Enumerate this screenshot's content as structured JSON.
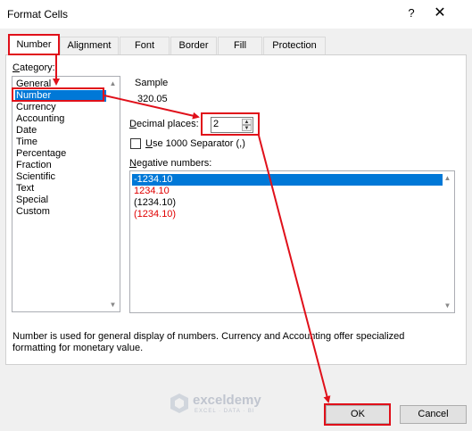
{
  "window": {
    "title": "Format Cells",
    "help_label": "?",
    "close_label": "✕"
  },
  "tabs": [
    {
      "label": "Number",
      "active": true
    },
    {
      "label": "Alignment",
      "active": false
    },
    {
      "label": "Font",
      "active": false
    },
    {
      "label": "Border",
      "active": false
    },
    {
      "label": "Fill",
      "active": false
    },
    {
      "label": "Protection",
      "active": false
    }
  ],
  "category": {
    "label": "Category",
    "label_rest": "ategory:",
    "label_accel": "C",
    "items": [
      "General",
      "Number",
      "Currency",
      "Accounting",
      "Date",
      "Time",
      "Percentage",
      "Fraction",
      "Scientific",
      "Text",
      "Special",
      "Custom"
    ],
    "selected": "Number"
  },
  "sample": {
    "label": "Sample",
    "value": "320.05"
  },
  "decimal_places": {
    "label_accel": "D",
    "label_rest": "ecimal places:",
    "value": "2"
  },
  "separator": {
    "label_accel": "U",
    "label_rest": "se 1000 Separator (,)",
    "checked": false
  },
  "negative_numbers": {
    "label_accel": "N",
    "label_rest": "egative numbers:",
    "items": [
      {
        "text": "-1234.10",
        "color": "#000000",
        "selected": true
      },
      {
        "text": "1234.10",
        "color": "#e00000",
        "selected": false
      },
      {
        "text": "(1234.10)",
        "color": "#000000",
        "selected": false
      },
      {
        "text": "(1234.10)",
        "color": "#e00000",
        "selected": false
      }
    ]
  },
  "description": {
    "line1": "Number is used for general display of numbers.  Currency and Accounting offer specialized",
    "line2": "formatting for monetary value."
  },
  "buttons": {
    "ok": "OK",
    "cancel": "Cancel"
  },
  "watermark": {
    "name": "exceldemy",
    "tagline": "EXCEL · DATA · BI"
  },
  "colors": {
    "accent": "#0078d7",
    "highlight_red": "#e0101a",
    "negative_red": "#e00000"
  }
}
